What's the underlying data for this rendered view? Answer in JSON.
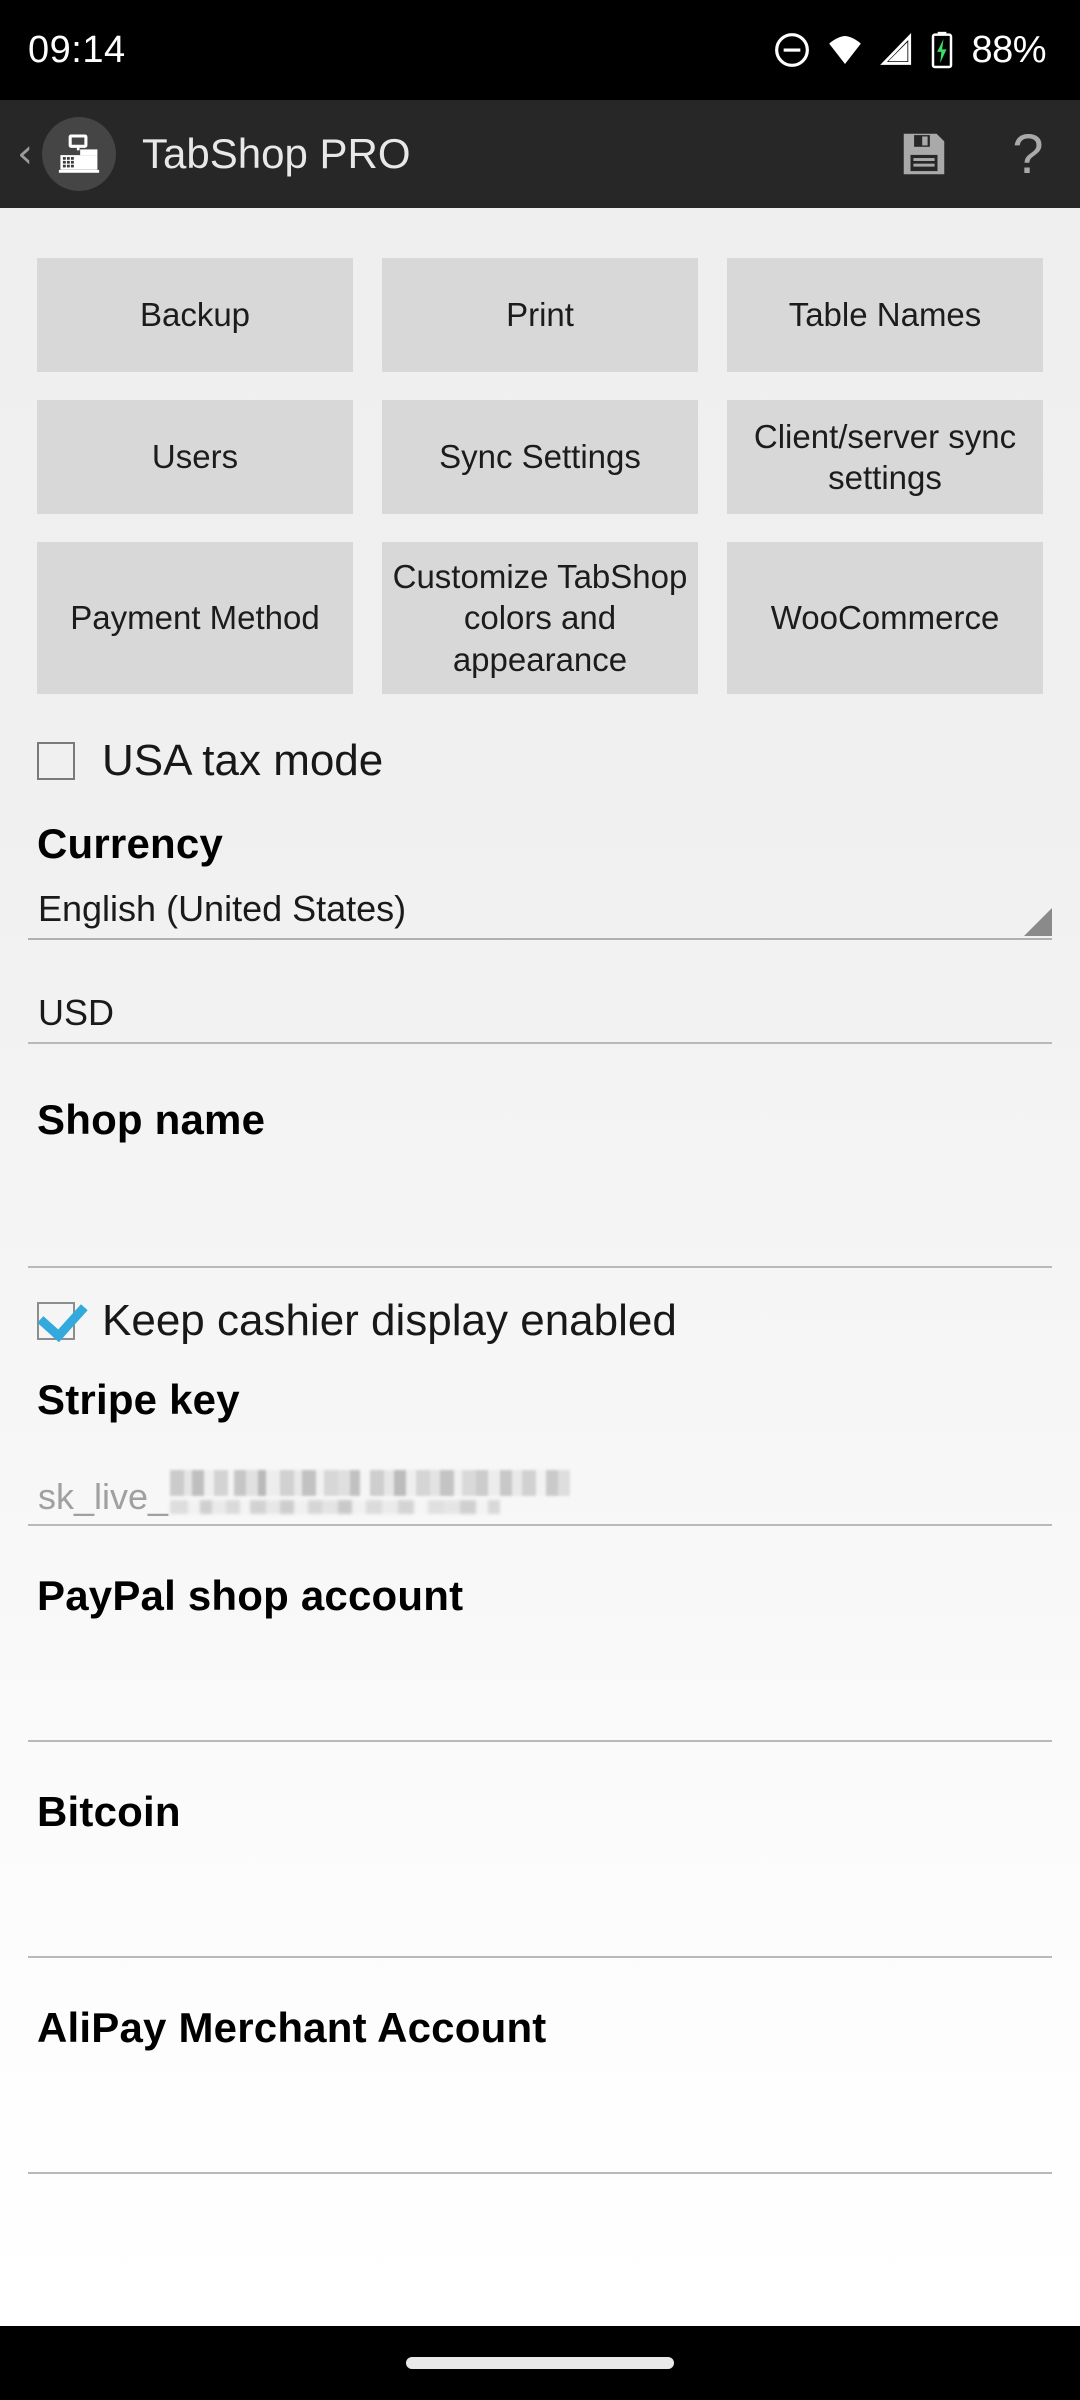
{
  "status_bar": {
    "time": "09:14",
    "battery_percent": "88%",
    "icons": [
      "do-not-disturb-icon",
      "wifi-icon",
      "cellular-signal-icon",
      "battery-charging-icon"
    ]
  },
  "app_bar": {
    "back_label": "‹",
    "app_icon": "cash-register-icon",
    "title": "TabShop PRO",
    "save_icon": "floppy-disk-save-icon",
    "help_label": "?"
  },
  "settings_buttons": {
    "row1": [
      {
        "label": "Backup"
      },
      {
        "label": "Print"
      },
      {
        "label": "Table Names"
      }
    ],
    "row2": [
      {
        "label": "Users"
      },
      {
        "label": "Sync Settings"
      },
      {
        "label": "Client/server sync settings"
      }
    ],
    "row3": [
      {
        "label": "Payment Method"
      },
      {
        "label": "Customize TabShop colors and appearance"
      },
      {
        "label": "WooCommerce"
      }
    ]
  },
  "checkboxes": {
    "usa_tax_mode": {
      "label": "USA tax mode",
      "checked": false
    },
    "cashier_display": {
      "label": "Keep cashier display enabled",
      "checked": true
    }
  },
  "sections": {
    "currency": {
      "heading": "Currency",
      "locale_value": "English (United States)",
      "locale_spinner_icon": "dropdown-triangle-icon",
      "code_value": "USD"
    },
    "shop_name": {
      "heading": "Shop name",
      "value": ""
    },
    "stripe_key": {
      "heading": "Stripe key",
      "value_prefix": "sk_live_",
      "value_redacted": true
    },
    "paypal": {
      "heading": "PayPal shop account",
      "value": ""
    },
    "bitcoin": {
      "heading": "Bitcoin",
      "value": ""
    },
    "alipay": {
      "heading": "AliPay Merchant Account",
      "value": ""
    }
  },
  "nav_bar": {
    "gesture_pill": "home-gesture-pill"
  },
  "colors": {
    "status_bar_bg": "#000000",
    "app_bar_bg": "#272727",
    "content_bg": "#f0f0f0",
    "button_bg": "#d8d8d8",
    "checkbox_accent": "#33a9dc",
    "battery_charging": "#3ddc63"
  }
}
